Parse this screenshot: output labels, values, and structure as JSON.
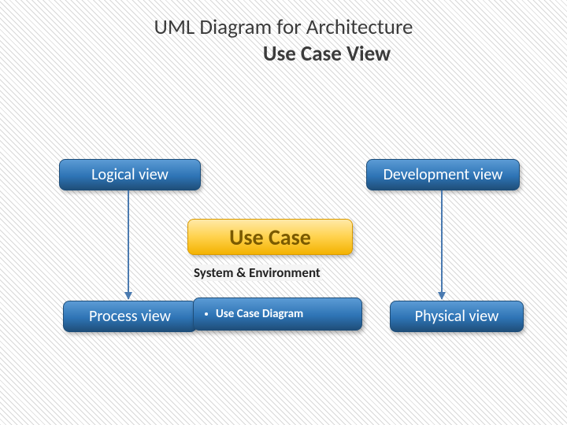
{
  "title": {
    "line1": "UML Diagram for Architecture",
    "line2": "Use Case View"
  },
  "views": {
    "topLeft": "Logical view",
    "topRight": "Development view",
    "center": "Use Case",
    "systemEnv": "System & Environment",
    "bottomLeft": "Process view",
    "bottomRight": "Physical view"
  },
  "bullets": {
    "useCaseDiagram": "Use Case Diagram"
  },
  "colors": {
    "blueTop": "#5b9bd5",
    "blueBottom": "#1f4e79",
    "goldTop": "#ffe9a8",
    "goldBottom": "#f3b200",
    "arrow": "#4a7ab0"
  }
}
